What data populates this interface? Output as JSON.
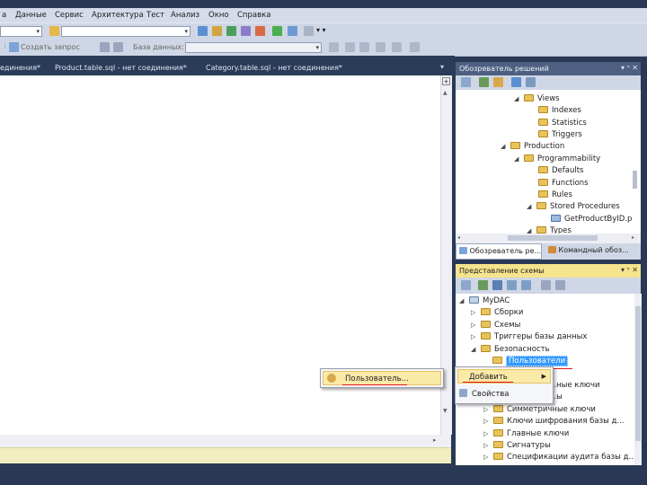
{
  "menu": [
    "а",
    "Данные",
    "Сервис",
    "Архитектура",
    "Тест",
    "Анализ",
    "Окно",
    "Справка"
  ],
  "toolbar2": {
    "create_query": "Создать запрос",
    "database_label": "База данных:"
  },
  "doc_tabs": [
    "единения*",
    "Product.table.sql - нет соединения*",
    "Category.table.sql - нет соединения*"
  ],
  "solution_explorer": {
    "title": "Обозреватель решений",
    "tree": [
      "Views",
      "Indexes",
      "Statistics",
      "Triggers",
      "Production",
      "Programmability",
      "Defaults",
      "Functions",
      "Rules",
      "Stored Procedures",
      "GetProductByID.p",
      "Types"
    ],
    "tab_left": "Обозреватель ре...",
    "tab_right": "Командный обоз..."
  },
  "schema_view": {
    "title": "Представление схемы",
    "tree": [
      "MyDAC",
      "Сборки",
      "Схемы",
      "Триггеры базы данных",
      "Безопасность",
      "Пользователи",
      "...ные ключи",
      "...ы",
      "Симметричные ключи",
      "Ключи шифрования базы д...",
      "Главные ключи",
      "Сигнатуры",
      "Спецификации аудита базы д..."
    ]
  },
  "context_menu": {
    "add": "Добавить",
    "properties": "Свойства",
    "submenu_user": "Пользователь..."
  },
  "colors": {
    "accent_red": "#e21717",
    "selection_blue": "#3399ff",
    "title_bar": "#4d6082",
    "active_title": "#f5e38d"
  }
}
